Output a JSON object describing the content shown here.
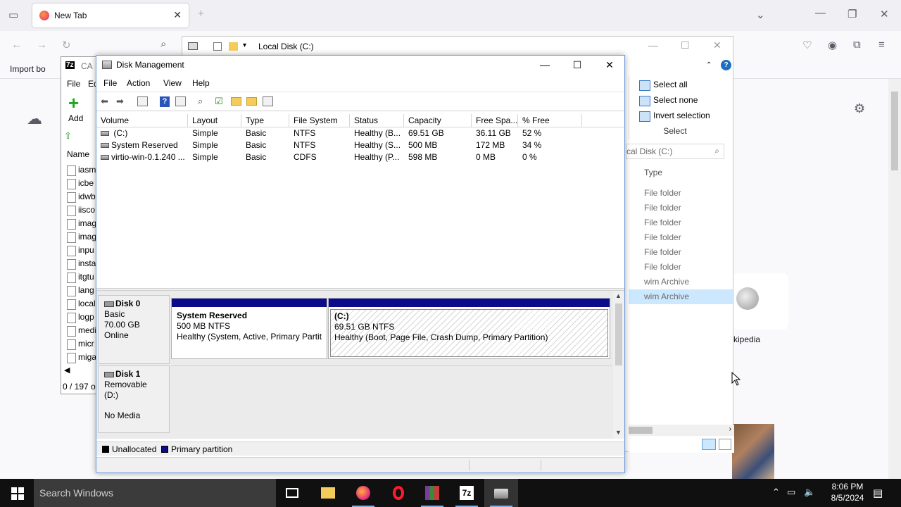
{
  "firefox": {
    "tab_title": "New Tab",
    "bookmark_import": "Import bo",
    "wiki_label": "kipedia"
  },
  "sevenzip": {
    "title": "CA",
    "menu_file": "File",
    "menu_edit": "Ed",
    "add_label": "Add",
    "col_name": "Name",
    "files": [
      "iasm",
      "icbe",
      "idwb",
      "iisco",
      "imag",
      "imag",
      "inpu",
      "insta",
      "itgtu",
      "lang",
      "local",
      "logp",
      "medi",
      "micr",
      "miga"
    ],
    "status": "0 / 197 o"
  },
  "explorer": {
    "title": "Local Disk (C:)",
    "ribbon": {
      "select_all": "Select all",
      "select_none": "Select none",
      "invert": "Invert selection",
      "group": "Select"
    },
    "search_placeholder": "cal Disk (C:)",
    "type_header": "Type",
    "rows": [
      "File folder",
      "File folder",
      "File folder",
      "File folder",
      "File folder",
      "File folder",
      "wim Archive",
      "wim Archive"
    ]
  },
  "diskmgmt": {
    "title": "Disk Management",
    "menu": {
      "file": "File",
      "action": "Action",
      "view": "View",
      "help": "Help"
    },
    "columns": [
      "Volume",
      "Layout",
      "Type",
      "File System",
      "Status",
      "Capacity",
      "Free Spa...",
      "% Free"
    ],
    "volumes": [
      {
        "volume": " (C:)",
        "layout": "Simple",
        "type": "Basic",
        "fs": "NTFS",
        "status": "Healthy (B...",
        "capacity": "69.51 GB",
        "free": "36.11 GB",
        "pct": "52 %"
      },
      {
        "volume": "System Reserved",
        "layout": "Simple",
        "type": "Basic",
        "fs": "NTFS",
        "status": "Healthy (S...",
        "capacity": "500 MB",
        "free": "172 MB",
        "pct": "34 %"
      },
      {
        "volume": "virtio-win-0.1.240 ...",
        "layout": "Simple",
        "type": "Basic",
        "fs": "CDFS",
        "status": "Healthy (P...",
        "capacity": "598 MB",
        "free": "0 MB",
        "pct": "0 %"
      }
    ],
    "disk0": {
      "name": "Disk 0",
      "type": "Basic",
      "size": "70.00 GB",
      "state": "Online"
    },
    "part_sr": {
      "name": "System Reserved",
      "size": "500 MB NTFS",
      "status": "Healthy (System, Active, Primary Partiti"
    },
    "part_c": {
      "name": "(C:)",
      "size": "69.51 GB NTFS",
      "status": "Healthy (Boot, Page File, Crash Dump, Primary Partition)"
    },
    "disk1": {
      "name": "Disk 1",
      "type": "Removable (D:)",
      "state": "No Media"
    },
    "legend": {
      "unallocated": "Unallocated",
      "primary": "Primary partition"
    },
    "colors": {
      "primary": "#0b0b8c",
      "unallocated": "#000000"
    }
  },
  "taskbar": {
    "search_placeholder": "Search Windows",
    "time": "8:06 PM",
    "date": "8/5/2024"
  }
}
